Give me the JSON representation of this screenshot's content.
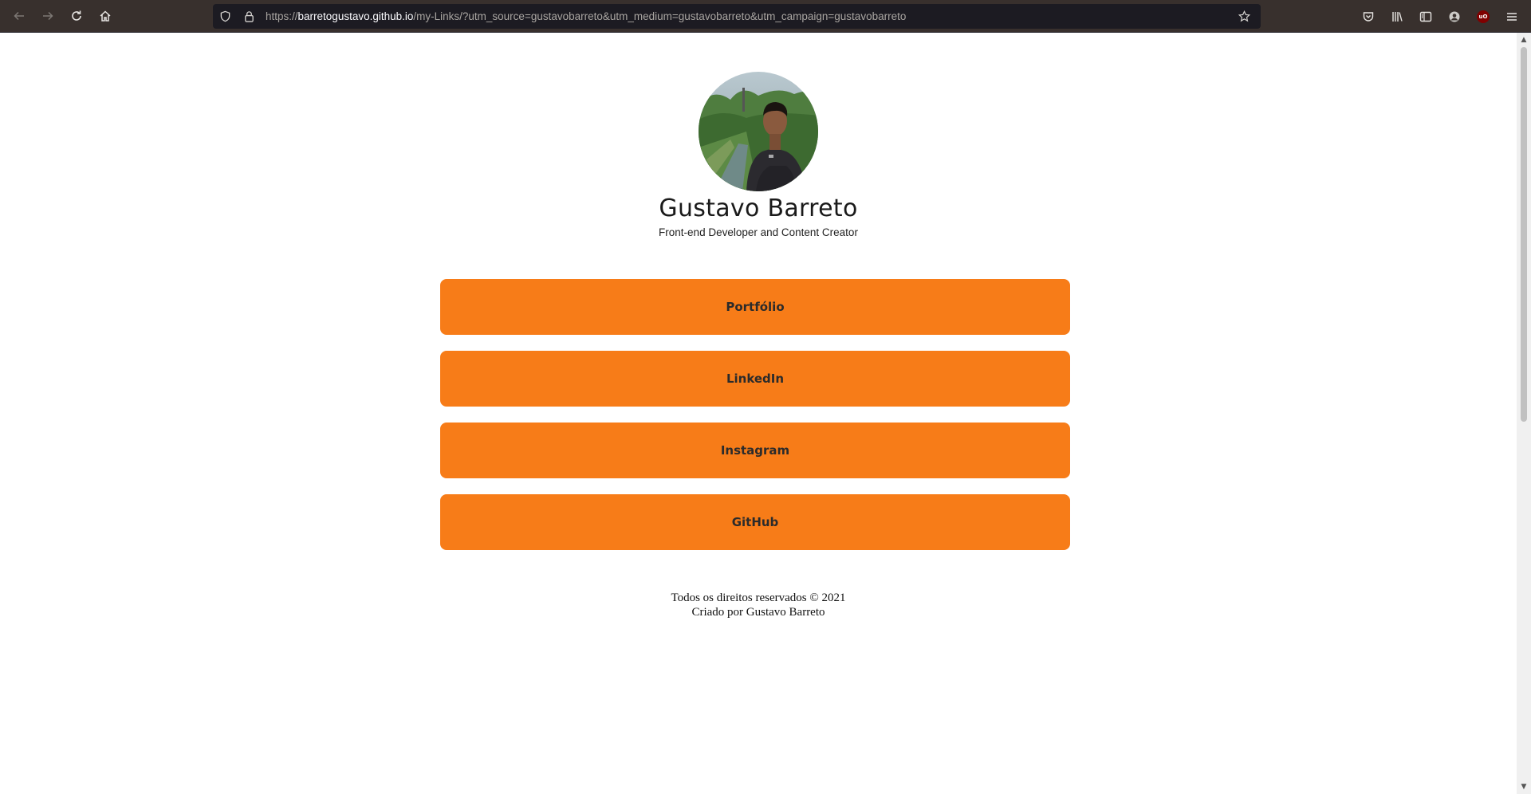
{
  "browser": {
    "url_prefix": "https://",
    "url_host": "barretogustavo.github.io",
    "url_rest": "/my-Links/?utm_source=gustavobarreto&utm_medium=gustavobarreto&utm_campaign=gustavobarreto",
    "icons": {
      "back": "arrow-left-icon",
      "forward": "arrow-right-icon",
      "reload": "reload-icon",
      "home": "home-icon",
      "tracking": "shield-icon",
      "lock": "lock-icon",
      "bookmark": "star-icon",
      "pocket": "pocket-icon",
      "library": "library-icon",
      "sidebar": "sidebar-icon",
      "sync": "account-icon",
      "ublock": "ublock-icon",
      "menu": "hamburger-menu-icon"
    },
    "ublock_label": "uO"
  },
  "profile": {
    "name": "Gustavo Barreto",
    "subtitle": "Front-end Developer and Content Creator"
  },
  "links": [
    {
      "label": "Portfólio"
    },
    {
      "label": "LinkedIn"
    },
    {
      "label": "Instagram"
    },
    {
      "label": "GitHub"
    }
  ],
  "footer": {
    "line1": "Todos os direitos reservados © 2021",
    "line2": "Criado por Gustavo Barreto"
  },
  "colors": {
    "button": "#f77c18",
    "toolbar": "#38302d",
    "urlbar": "#1c1b22"
  }
}
